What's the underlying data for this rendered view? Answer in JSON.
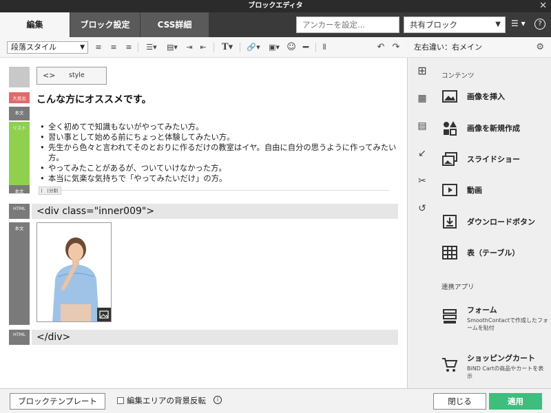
{
  "window": {
    "title": "ブロックエディタ"
  },
  "tabs": [
    {
      "label": "編集",
      "active": true
    },
    {
      "label": "ブロック設定",
      "active": false
    },
    {
      "label": "CSS詳細",
      "active": false
    }
  ],
  "header": {
    "anchor_placeholder": "アンカーを設定...",
    "shared_block": "共有ブロック"
  },
  "toolbar": {
    "paragraph_style": "段落スタイル"
  },
  "editor": {
    "style_label": "style",
    "gutters": [
      "大見出",
      "本文",
      "リスト",
      "本文",
      "HTML",
      "本文",
      "HTML"
    ],
    "heading": "こんな方にオススメです。",
    "bullets": [
      "全く初めてで知識もないがやってみたい方。",
      "習い事として始める前にちょっと体験してみたい方。",
      "先生から色々と言われてそのとおりに作るだけの教室はイヤ。自由に自分の思うように作ってみたい方。",
      "やってみたことがあるが、ついていけなかった方。",
      "本当に気楽な気持ちで「やってみたいだけ」の方。"
    ],
    "divider_label": "分割",
    "html_open": "<div class=\"inner009\">",
    "html_close": "</div>"
  },
  "sidebar": {
    "title": "左右違い：右メイン",
    "contents_heading": "コンテンツ",
    "items": [
      {
        "label": "画像を挿入",
        "icon": "image-icon"
      },
      {
        "label": "画像を新規作成",
        "icon": "shapes-icon"
      },
      {
        "label": "スライドショー",
        "icon": "slideshow-icon"
      },
      {
        "label": "動画",
        "icon": "video-icon"
      },
      {
        "label": "ダウンロードボタン",
        "icon": "download-icon"
      },
      {
        "label": "表（テーブル）",
        "icon": "table-icon"
      }
    ],
    "apps_heading": "連携アプリ",
    "apps": [
      {
        "label": "フォーム",
        "desc": "SmoothContactで作成したフォームを貼付",
        "icon": "form-icon"
      },
      {
        "label": "ショッピングカート",
        "desc": "BiND Cartの商品やカートを表示",
        "icon": "cart-icon"
      }
    ]
  },
  "footer": {
    "template_button": "ブロックテンプレート",
    "bg_toggle_label": "編集エリアの背景反転",
    "close": "閉じる",
    "apply": "適用"
  },
  "colors": {
    "apply_green": "#3dbe7d",
    "heading_tag_red": "#e26a6a",
    "list_tag_green": "#8fd14f"
  }
}
